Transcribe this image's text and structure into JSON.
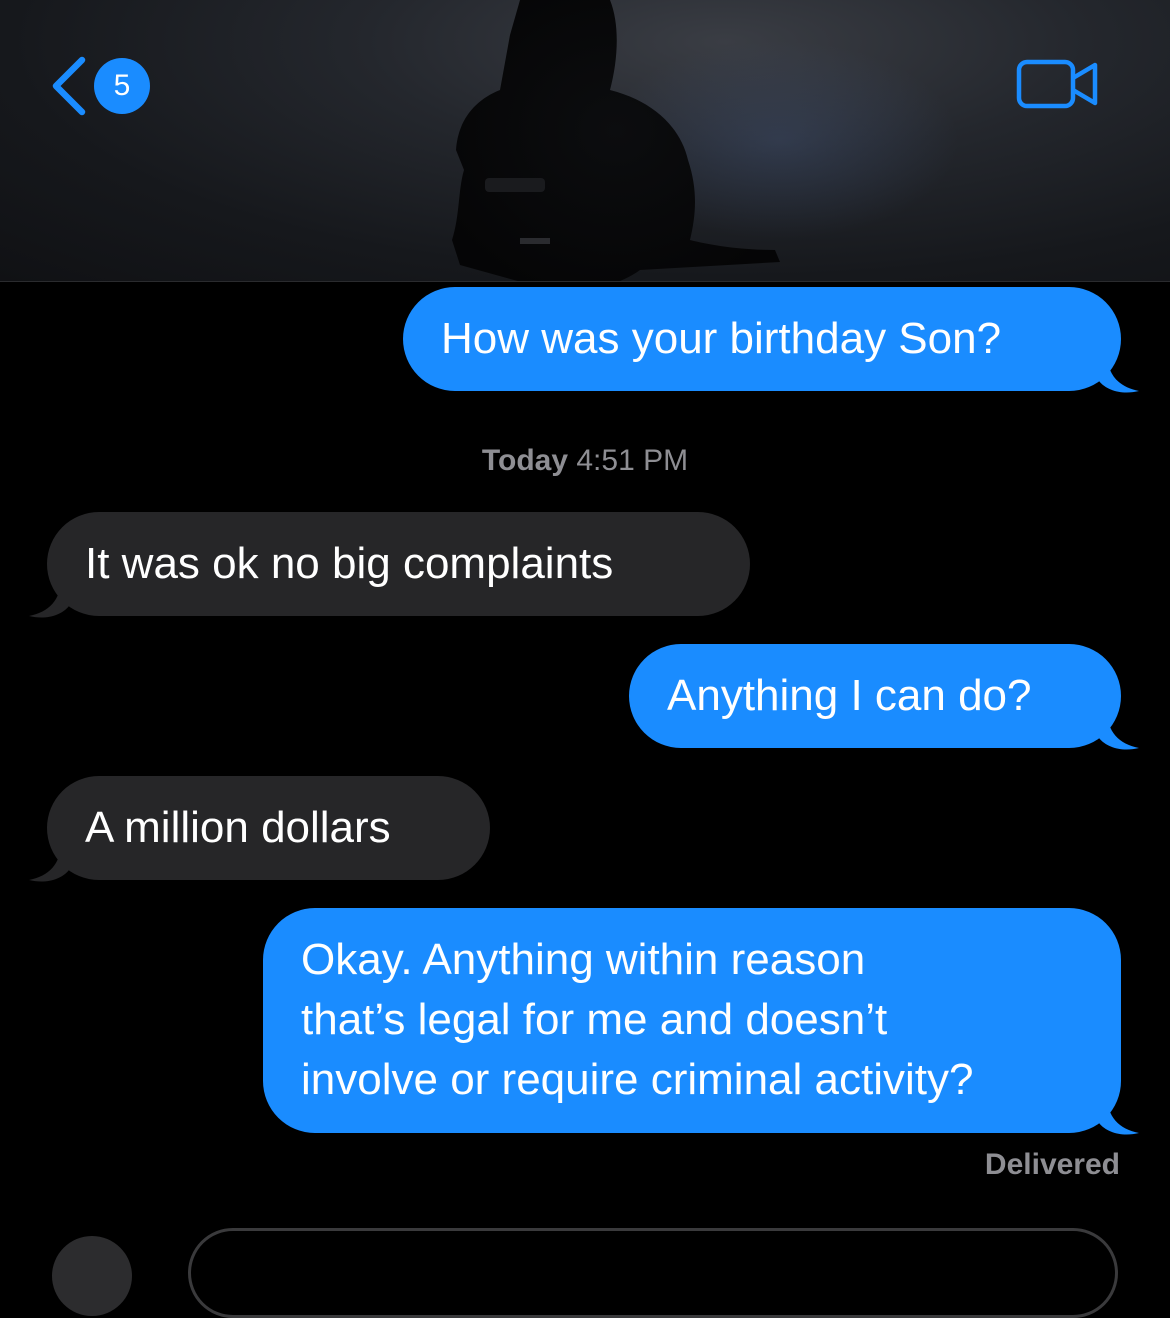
{
  "header": {
    "back_badge_count": "5",
    "icons": {
      "back": "chevron-left-icon",
      "video": "video-camera-icon"
    },
    "accent_color": "#1a8cff"
  },
  "conversation": {
    "messages": [
      {
        "direction": "outgoing",
        "text": "How was your birthday Son?"
      },
      {
        "direction": "incoming",
        "text": "It was ok no big complaints"
      },
      {
        "direction": "outgoing",
        "text": "Anything I can do?"
      },
      {
        "direction": "incoming",
        "text": "A million dollars"
      },
      {
        "direction": "outgoing",
        "lines": [
          "Okay. Anything within reason",
          "that’s legal for me and doesn’t",
          "involve or require criminal activity?"
        ]
      }
    ],
    "timestamp": {
      "day": "Today",
      "time": "4:51 PM"
    },
    "delivery_status": "Delivered"
  },
  "colors": {
    "outgoing_bubble": "#1a8cff",
    "incoming_bubble": "#262628",
    "meta_text": "#8e8e93"
  }
}
